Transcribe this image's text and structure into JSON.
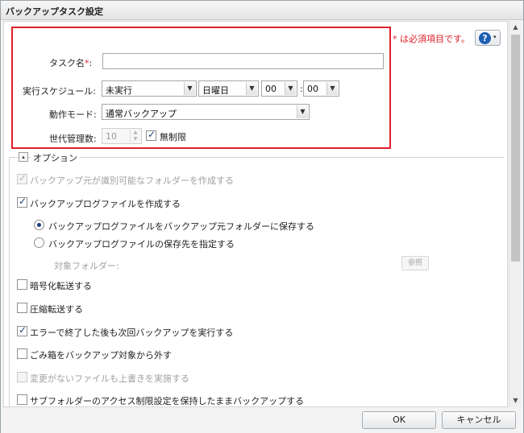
{
  "window": {
    "title": "バックアップタスク設定"
  },
  "required_note": "* は必須項目です。",
  "help": {
    "icon": "question-mark-icon",
    "symbol": "?",
    "caret": "▾"
  },
  "form": {
    "task_name": {
      "label": "タスク名",
      "required_mark": "*",
      "colon": ":",
      "value": ""
    },
    "schedule": {
      "label": "実行スケジュール:",
      "frequency": "未実行",
      "day": "日曜日",
      "hour": "00",
      "minute": "00",
      "time_separator": ":"
    },
    "mode": {
      "label": "動作モード:",
      "value": "通常バックアップ"
    },
    "generations": {
      "label": "世代管理数:",
      "value": "10",
      "unlimited_label": "無制限",
      "unlimited_checked": true
    }
  },
  "options": {
    "section_label": "オプション",
    "toggle_symbol": "▴",
    "items": [
      {
        "label": "バックアップ元が識別可能なフォルダーを作成する",
        "checked": true,
        "disabled": true
      },
      {
        "label": "バックアップログファイルを作成する",
        "checked": true,
        "disabled": false
      },
      {
        "label": "バックアップログファイルをバックアップ元フォルダーに保存する",
        "type": "radio",
        "checked": true
      },
      {
        "label": "バックアップログファイルの保存先を指定する",
        "type": "radio",
        "checked": false
      },
      {
        "label": "対象フォルダー:",
        "type": "label",
        "disabled": true
      },
      {
        "label": "暗号化転送する",
        "checked": false,
        "disabled": false
      },
      {
        "label": "圧縮転送する",
        "checked": false,
        "disabled": false
      },
      {
        "label": "エラーで終了した後も次回バックアップを実行する",
        "checked": true,
        "disabled": false
      },
      {
        "label": "ごみ箱をバックアップ対象から外す",
        "checked": false,
        "disabled": false
      },
      {
        "label": "変更がないファイルも上書きを実施する",
        "checked": false,
        "disabled": true
      },
      {
        "label": "サブフォルダーのアクセス制限設定を保持したままバックアップする",
        "checked": false,
        "disabled": false
      }
    ],
    "browse_button": "参照"
  },
  "buttons": {
    "ok": "OK",
    "cancel": "キャンセル"
  },
  "colors": {
    "required": "#e0202a",
    "highlight_box": "#e0202a",
    "help_icon": "#1e5fb4"
  }
}
